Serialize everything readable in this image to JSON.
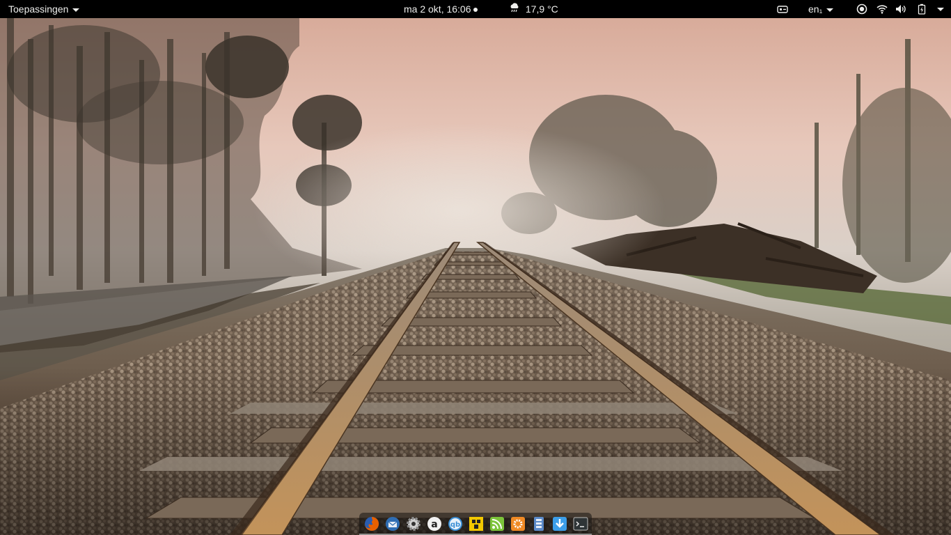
{
  "topbar": {
    "activities_label": "Toepassingen",
    "clock": "ma  2 okt, 16:06",
    "weather": "17,9 °C",
    "keyboard_layout": "en₁",
    "icons": [
      "network-indicator-icon",
      "accessibility-icon",
      "wifi-icon",
      "volume-icon",
      "battery-charging-icon"
    ]
  },
  "desktop": {
    "wallpaper": "railroad tracks in fog"
  },
  "dock": {
    "apps": [
      {
        "name": "firefox-icon",
        "color": "#e66000"
      },
      {
        "name": "thunderbird-icon",
        "color": "#2f6db3"
      },
      {
        "name": "settings-icon",
        "color": "#d0d0d0"
      },
      {
        "name": "amazon-icon",
        "color": "#f2f2f2"
      },
      {
        "name": "qbittorrent-icon",
        "color": "#3b8fd6"
      },
      {
        "name": "file-sync-icon",
        "color": "#f3c800"
      },
      {
        "name": "rss-reader-icon",
        "color": "#7cc43a"
      },
      {
        "name": "software-icon",
        "color": "#f08a24"
      },
      {
        "name": "archive-manager-icon",
        "color": "#5b8ac8"
      },
      {
        "name": "downloads-icon",
        "color": "#3c9ee8"
      },
      {
        "name": "terminal-icon",
        "color": "#2e3436"
      }
    ]
  }
}
